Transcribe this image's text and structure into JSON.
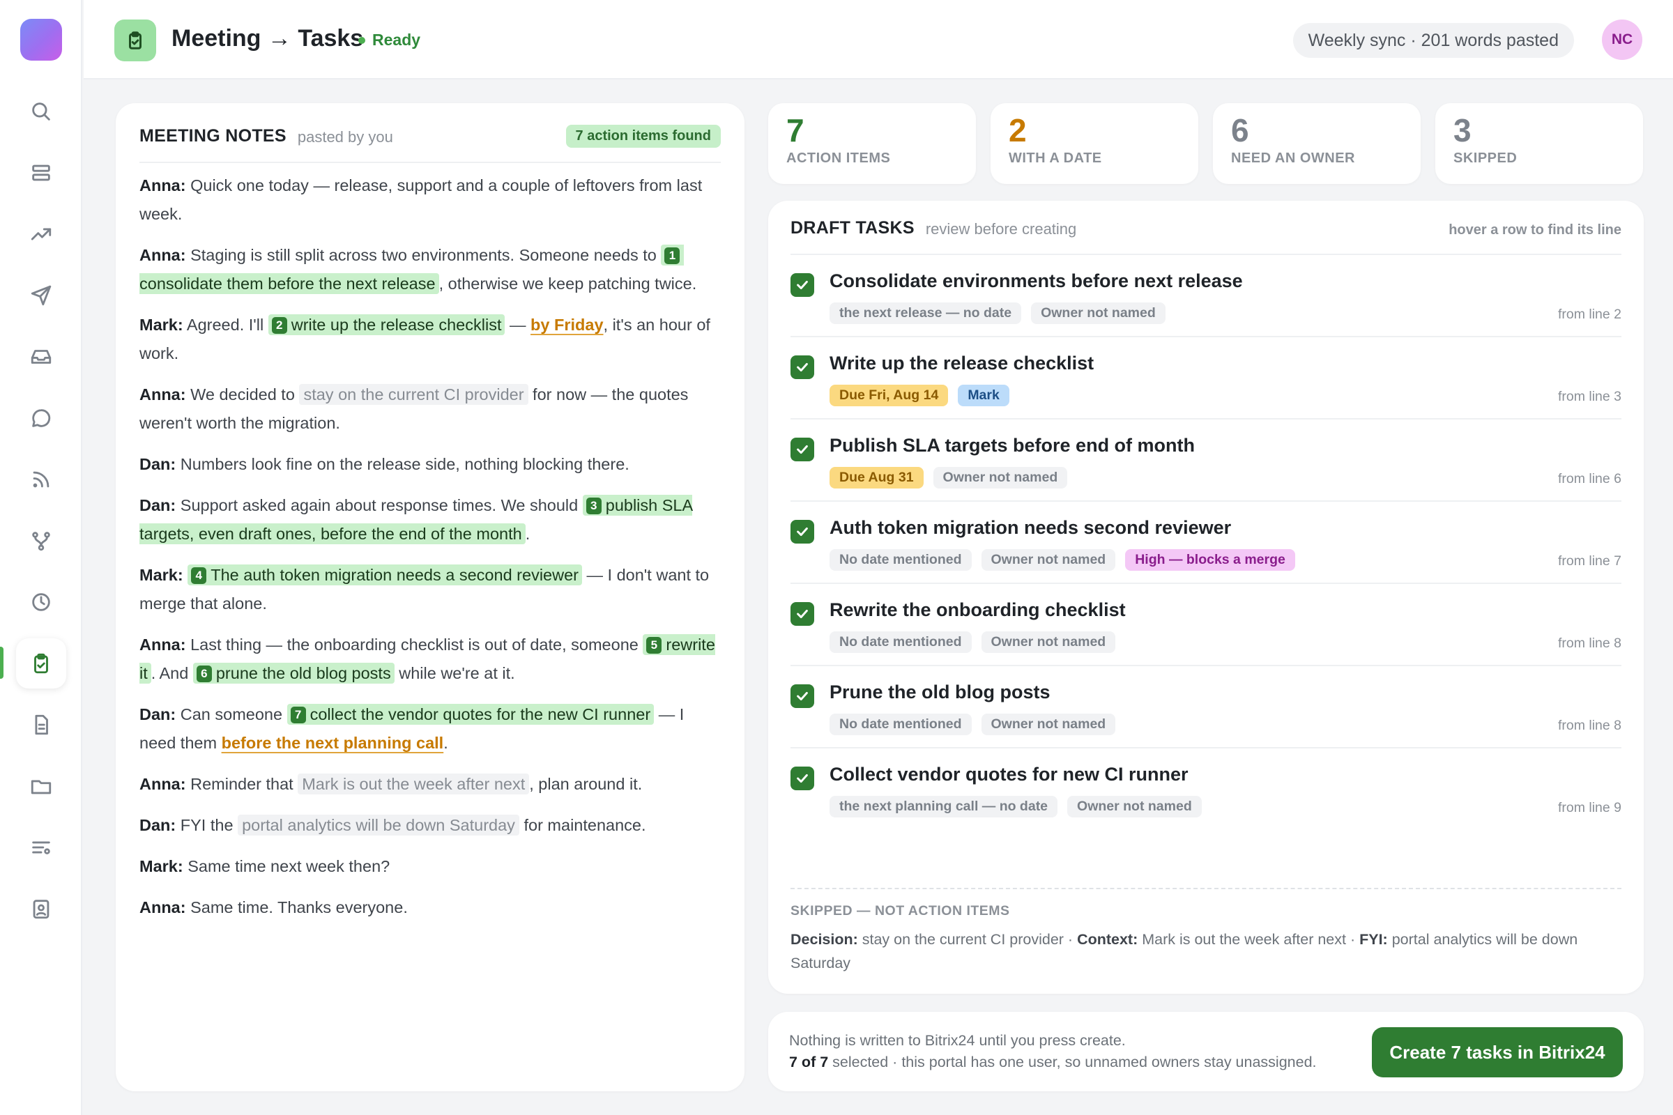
{
  "header": {
    "title": "Meeting → Tasks",
    "status": "Ready",
    "session": "Weekly sync · 201 words pasted",
    "avatar": "NC"
  },
  "sidebar": {
    "items": [
      "search-icon",
      "layers-icon",
      "trending-icon",
      "send-icon",
      "inbox-icon",
      "chat-icon",
      "rss-icon",
      "branch-icon",
      "clock-icon",
      "clipboard-check-icon",
      "document-icon",
      "folder-icon",
      "filter-list-icon",
      "id-badge-icon"
    ],
    "active": "clipboard-check-icon"
  },
  "notes": {
    "title": "MEETING NOTES",
    "subtitle": "pasted by you",
    "badge": "7 action items found",
    "lines": [
      {
        "speaker": "Anna:",
        "segments": [
          {
            "t": "text",
            "v": " Quick one today — release, support and a couple of leftovers from last week."
          }
        ]
      },
      {
        "speaker": "Anna:",
        "segments": [
          {
            "t": "text",
            "v": " Staging is still split across two environments. Someone needs to "
          },
          {
            "t": "action",
            "n": "1",
            "v": "consolidate them before the next release"
          },
          {
            "t": "text",
            "v": ", otherwise we keep patching twice."
          }
        ]
      },
      {
        "speaker": "Mark:",
        "segments": [
          {
            "t": "text",
            "v": " Agreed. I'll "
          },
          {
            "t": "action",
            "n": "2",
            "v": "write up the release checklist"
          },
          {
            "t": "text",
            "v": " — "
          },
          {
            "t": "date",
            "v": "by Friday"
          },
          {
            "t": "text",
            "v": ", it's an hour of work."
          }
        ]
      },
      {
        "speaker": "Anna:",
        "segments": [
          {
            "t": "text",
            "v": " We decided to "
          },
          {
            "t": "skip",
            "v": "stay on the current CI provider"
          },
          {
            "t": "text",
            "v": " for now — the quotes weren't worth the migration."
          }
        ]
      },
      {
        "speaker": "Dan:",
        "segments": [
          {
            "t": "text",
            "v": " Numbers look fine on the release side, nothing blocking there."
          }
        ]
      },
      {
        "speaker": "Dan:",
        "segments": [
          {
            "t": "text",
            "v": " Support asked again about response times. We should "
          },
          {
            "t": "action",
            "n": "3",
            "v": "publish SLA targets, even draft ones, before the end of the month"
          },
          {
            "t": "text",
            "v": "."
          }
        ]
      },
      {
        "speaker": "Mark:",
        "segments": [
          {
            "t": "text",
            "v": " "
          },
          {
            "t": "action",
            "n": "4",
            "v": "The auth token migration needs a second reviewer"
          },
          {
            "t": "text",
            "v": " — I don't want to merge that alone."
          }
        ]
      },
      {
        "speaker": "Anna:",
        "segments": [
          {
            "t": "text",
            "v": " Last thing — the onboarding checklist is out of date, someone "
          },
          {
            "t": "action",
            "n": "5",
            "v": "rewrite it"
          },
          {
            "t": "text",
            "v": ". And "
          },
          {
            "t": "action",
            "n": "6",
            "v": "prune the old blog posts"
          },
          {
            "t": "text",
            "v": " while we're at it."
          }
        ]
      },
      {
        "speaker": "Dan:",
        "segments": [
          {
            "t": "text",
            "v": " Can someone "
          },
          {
            "t": "action",
            "n": "7",
            "v": "collect the vendor quotes for the new CI runner"
          },
          {
            "t": "text",
            "v": " — I need them "
          },
          {
            "t": "date",
            "v": "before the next planning call"
          },
          {
            "t": "text",
            "v": "."
          }
        ]
      },
      {
        "speaker": "Anna:",
        "segments": [
          {
            "t": "text",
            "v": " Reminder that "
          },
          {
            "t": "skip",
            "v": "Mark is out the week after next"
          },
          {
            "t": "text",
            "v": ", plan around it."
          }
        ]
      },
      {
        "speaker": "Dan:",
        "segments": [
          {
            "t": "text",
            "v": " FYI the "
          },
          {
            "t": "skip",
            "v": "portal analytics will be down Saturday"
          },
          {
            "t": "text",
            "v": " for maintenance."
          }
        ]
      },
      {
        "speaker": "Mark:",
        "segments": [
          {
            "t": "text",
            "v": " Same time next week then?"
          }
        ]
      },
      {
        "speaker": "Anna:",
        "segments": [
          {
            "t": "text",
            "v": " Same time. Thanks everyone."
          }
        ]
      }
    ]
  },
  "stats": [
    {
      "value": "7",
      "label": "ACTION ITEMS",
      "color": "#2f7d32"
    },
    {
      "value": "2",
      "label": "WITH A DATE",
      "color": "#c77a00"
    },
    {
      "value": "6",
      "label": "NEED AN OWNER",
      "color": "#7c828b"
    },
    {
      "value": "3",
      "label": "SKIPPED",
      "color": "#7c828b"
    }
  ],
  "drafts": {
    "title": "DRAFT TASKS",
    "subtitle": "review before creating",
    "hint": "hover a row to find its line",
    "tasks": [
      {
        "title": "Consolidate environments before next release",
        "tags": [
          {
            "kind": "plain",
            "text": "the next release — no date"
          },
          {
            "kind": "plain",
            "text": "Owner not named"
          }
        ],
        "from": "from line 2"
      },
      {
        "title": "Write up the release checklist",
        "tags": [
          {
            "kind": "due",
            "text": "Due Fri, Aug 14"
          },
          {
            "kind": "owner",
            "text": "Mark"
          }
        ],
        "from": "from line 3"
      },
      {
        "title": "Publish SLA targets before end of month",
        "tags": [
          {
            "kind": "due",
            "text": "Due Aug 31"
          },
          {
            "kind": "plain",
            "text": "Owner not named"
          }
        ],
        "from": "from line 6"
      },
      {
        "title": "Auth token migration needs second reviewer",
        "tags": [
          {
            "kind": "plain",
            "text": "No date mentioned"
          },
          {
            "kind": "plain",
            "text": "Owner not named"
          },
          {
            "kind": "prio",
            "text": "High — blocks a merge"
          }
        ],
        "from": "from line 7"
      },
      {
        "title": "Rewrite the onboarding checklist",
        "tags": [
          {
            "kind": "plain",
            "text": "No date mentioned"
          },
          {
            "kind": "plain",
            "text": "Owner not named"
          }
        ],
        "from": "from line 8"
      },
      {
        "title": "Prune the old blog posts",
        "tags": [
          {
            "kind": "plain",
            "text": "No date mentioned"
          },
          {
            "kind": "plain",
            "text": "Owner not named"
          }
        ],
        "from": "from line 8"
      },
      {
        "title": "Collect vendor quotes for new CI runner",
        "tags": [
          {
            "kind": "plain",
            "text": "the next planning call — no date"
          },
          {
            "kind": "plain",
            "text": "Owner not named"
          }
        ],
        "from": "from line 9"
      }
    ],
    "skipped_title": "SKIPPED — NOT ACTION ITEMS",
    "skipped": [
      {
        "label": "Decision:",
        "text": " stay on the current CI provider"
      },
      {
        "label": "Context:",
        "text": " Mark is out the week after next"
      },
      {
        "label": "FYI:",
        "text": " portal analytics will be down Saturday"
      }
    ]
  },
  "footer": {
    "line1": "Nothing is written to Bitrix24 until you press create.",
    "count": "7 of 7",
    "line2": " selected · this portal has one user, so unnamed owners stay unassigned.",
    "button": "Create 7 tasks in Bitrix24"
  }
}
